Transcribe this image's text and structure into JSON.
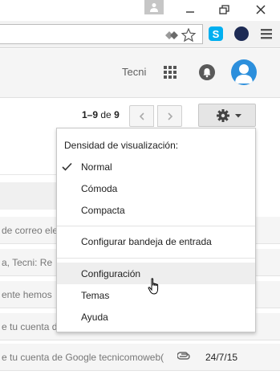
{
  "header": {
    "account_name": "Tecni"
  },
  "pagination": {
    "range": "1–9",
    "of_label": "de",
    "total": "9"
  },
  "settings_menu": {
    "density_heading": "Densidad de visualización:",
    "density_options": [
      {
        "label": "Normal",
        "checked": true
      },
      {
        "label": "Cómoda",
        "checked": false
      },
      {
        "label": "Compacta",
        "checked": false
      }
    ],
    "configure_inbox": "Configurar bandeja de entrada",
    "items": [
      {
        "label": "Configuración",
        "hovered": true
      },
      {
        "label": "Temas",
        "hovered": false
      },
      {
        "label": "Ayuda",
        "hovered": false
      }
    ]
  },
  "email_rows": [
    {
      "snippet": "de correo ele"
    },
    {
      "snippet": "a, Tecni: Re"
    },
    {
      "snippet": "ente hemos"
    },
    {
      "snippet": "e tu cuenta d"
    },
    {
      "snippet": "e tu cuenta de Google tecnicomoweb(",
      "date": "24/7/15",
      "has_attachment": true
    }
  ],
  "colors": {
    "avatar": "#2c8fdc",
    "skype": "#00aff0",
    "hover": "#eeeeee"
  }
}
